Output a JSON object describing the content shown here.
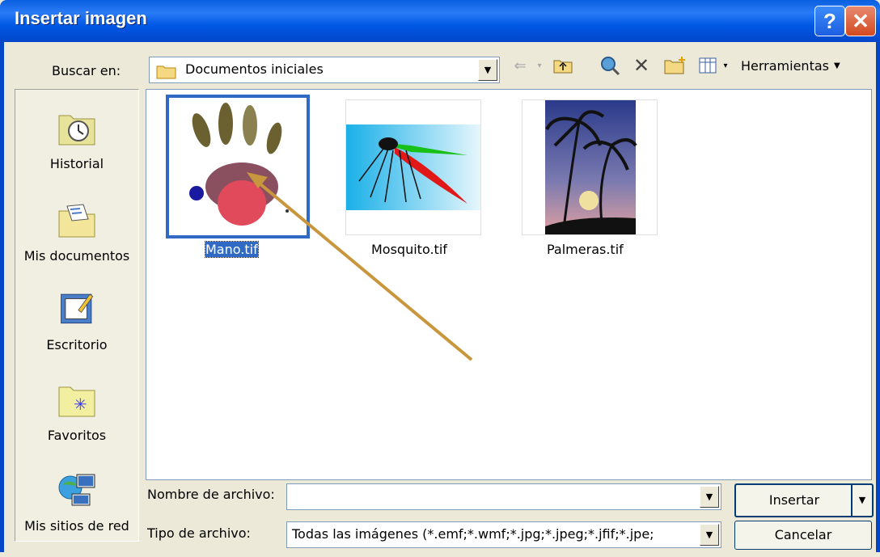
{
  "window": {
    "title": "Insertar imagen"
  },
  "lookin": {
    "label": "Buscar en:",
    "value": "Documentos iniciales"
  },
  "toolbar": {
    "tools_label": "Herramientas"
  },
  "places": [
    {
      "label": "Historial",
      "icon": "history-icon"
    },
    {
      "label": "Mis documentos",
      "icon": "my-documents-icon"
    },
    {
      "label": "Escritorio",
      "icon": "desktop-icon"
    },
    {
      "label": "Favoritos",
      "icon": "favorites-icon"
    },
    {
      "label": "Mis sitios de red",
      "icon": "network-places-icon"
    }
  ],
  "files": [
    {
      "name": "Mano.tif",
      "selected": true
    },
    {
      "name": "Mosquito.tif",
      "selected": false
    },
    {
      "name": "Palmeras.tif",
      "selected": false
    }
  ],
  "filename": {
    "label": "Nombre de archivo:",
    "value": ""
  },
  "filetype": {
    "label": "Tipo de archivo:",
    "value": "Todas las imágenes (*.emf;*.wmf;*.jpg;*.jpeg;*.jfif;*.jpe;"
  },
  "buttons": {
    "insert": "Insertar",
    "cancel": "Cancelar"
  },
  "colors": {
    "titlebar": "#0058E6",
    "selection": "#316AC5",
    "annotation_arrow": "#C8963C"
  }
}
